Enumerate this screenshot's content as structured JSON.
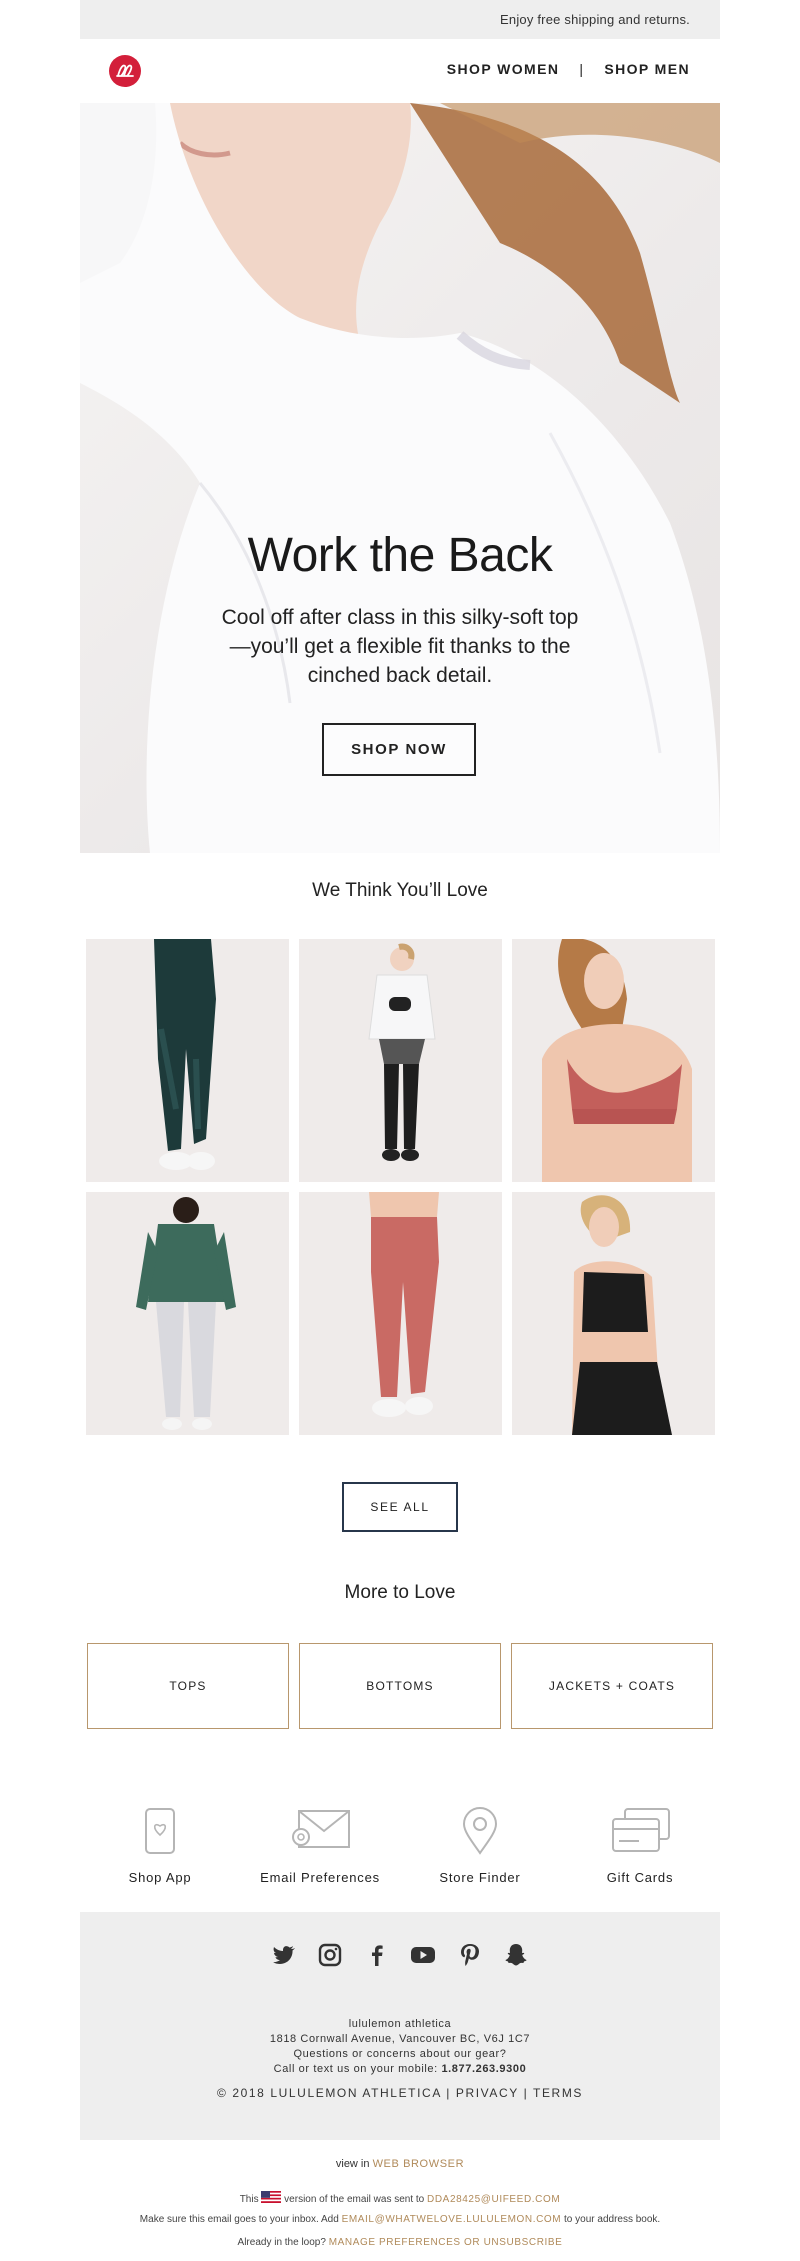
{
  "topbar": {
    "text": "Enjoy free shipping and returns."
  },
  "nav": {
    "women": "SHOP WOMEN",
    "separator": "|",
    "men": "SHOP MEN"
  },
  "hero": {
    "title": "Work the Back",
    "body": "Cool off after class in this silky-soft top—you’ll get a flexible fit thanks to the cinched back detail.",
    "cta": "SHOP NOW"
  },
  "recommend": {
    "title": "We Think You’ll Love",
    "see_all": "SEE ALL"
  },
  "more": {
    "title": "More to Love",
    "categories": [
      "TOPS",
      "BOTTOMS",
      "JACKETS + COATS"
    ]
  },
  "utilities": [
    "Shop App",
    "Email Preferences",
    "Store Finder",
    "Gift Cards"
  ],
  "footer": {
    "company": "lululemon athletica",
    "address": "1818 Cornwall Avenue, Vancouver BC, V6J 1C7",
    "questions": "Questions or concerns about our gear?",
    "call_prefix": "Call or text us on your mobile: ",
    "phone": "1.877.263.9300",
    "copyright": "© 2018 LULULEMON ATHLETICA",
    "privacy": "PRIVACY",
    "terms": "TERMS",
    "divider": "|"
  },
  "legal": {
    "view_prefix": "view in ",
    "web_browser": "WEB BROWSER",
    "this": "This",
    "version_text": "version of the email was sent to",
    "recipient": "DDA28425@UIFEED.COM",
    "inbox_prefix": "Make sure this email goes to your inbox. Add",
    "sender": "EMAIL@WHATWELOVE.LULULEMON.COM",
    "inbox_suffix": "to your address book.",
    "loop_prefix": "Already in the loop?",
    "manage": "MANAGE PREFERENCES OR UNSUBSCRIBE"
  },
  "colors": {
    "brand_red": "#d31f3a",
    "gold": "#b08a5a",
    "navy_border": "#27364b"
  }
}
